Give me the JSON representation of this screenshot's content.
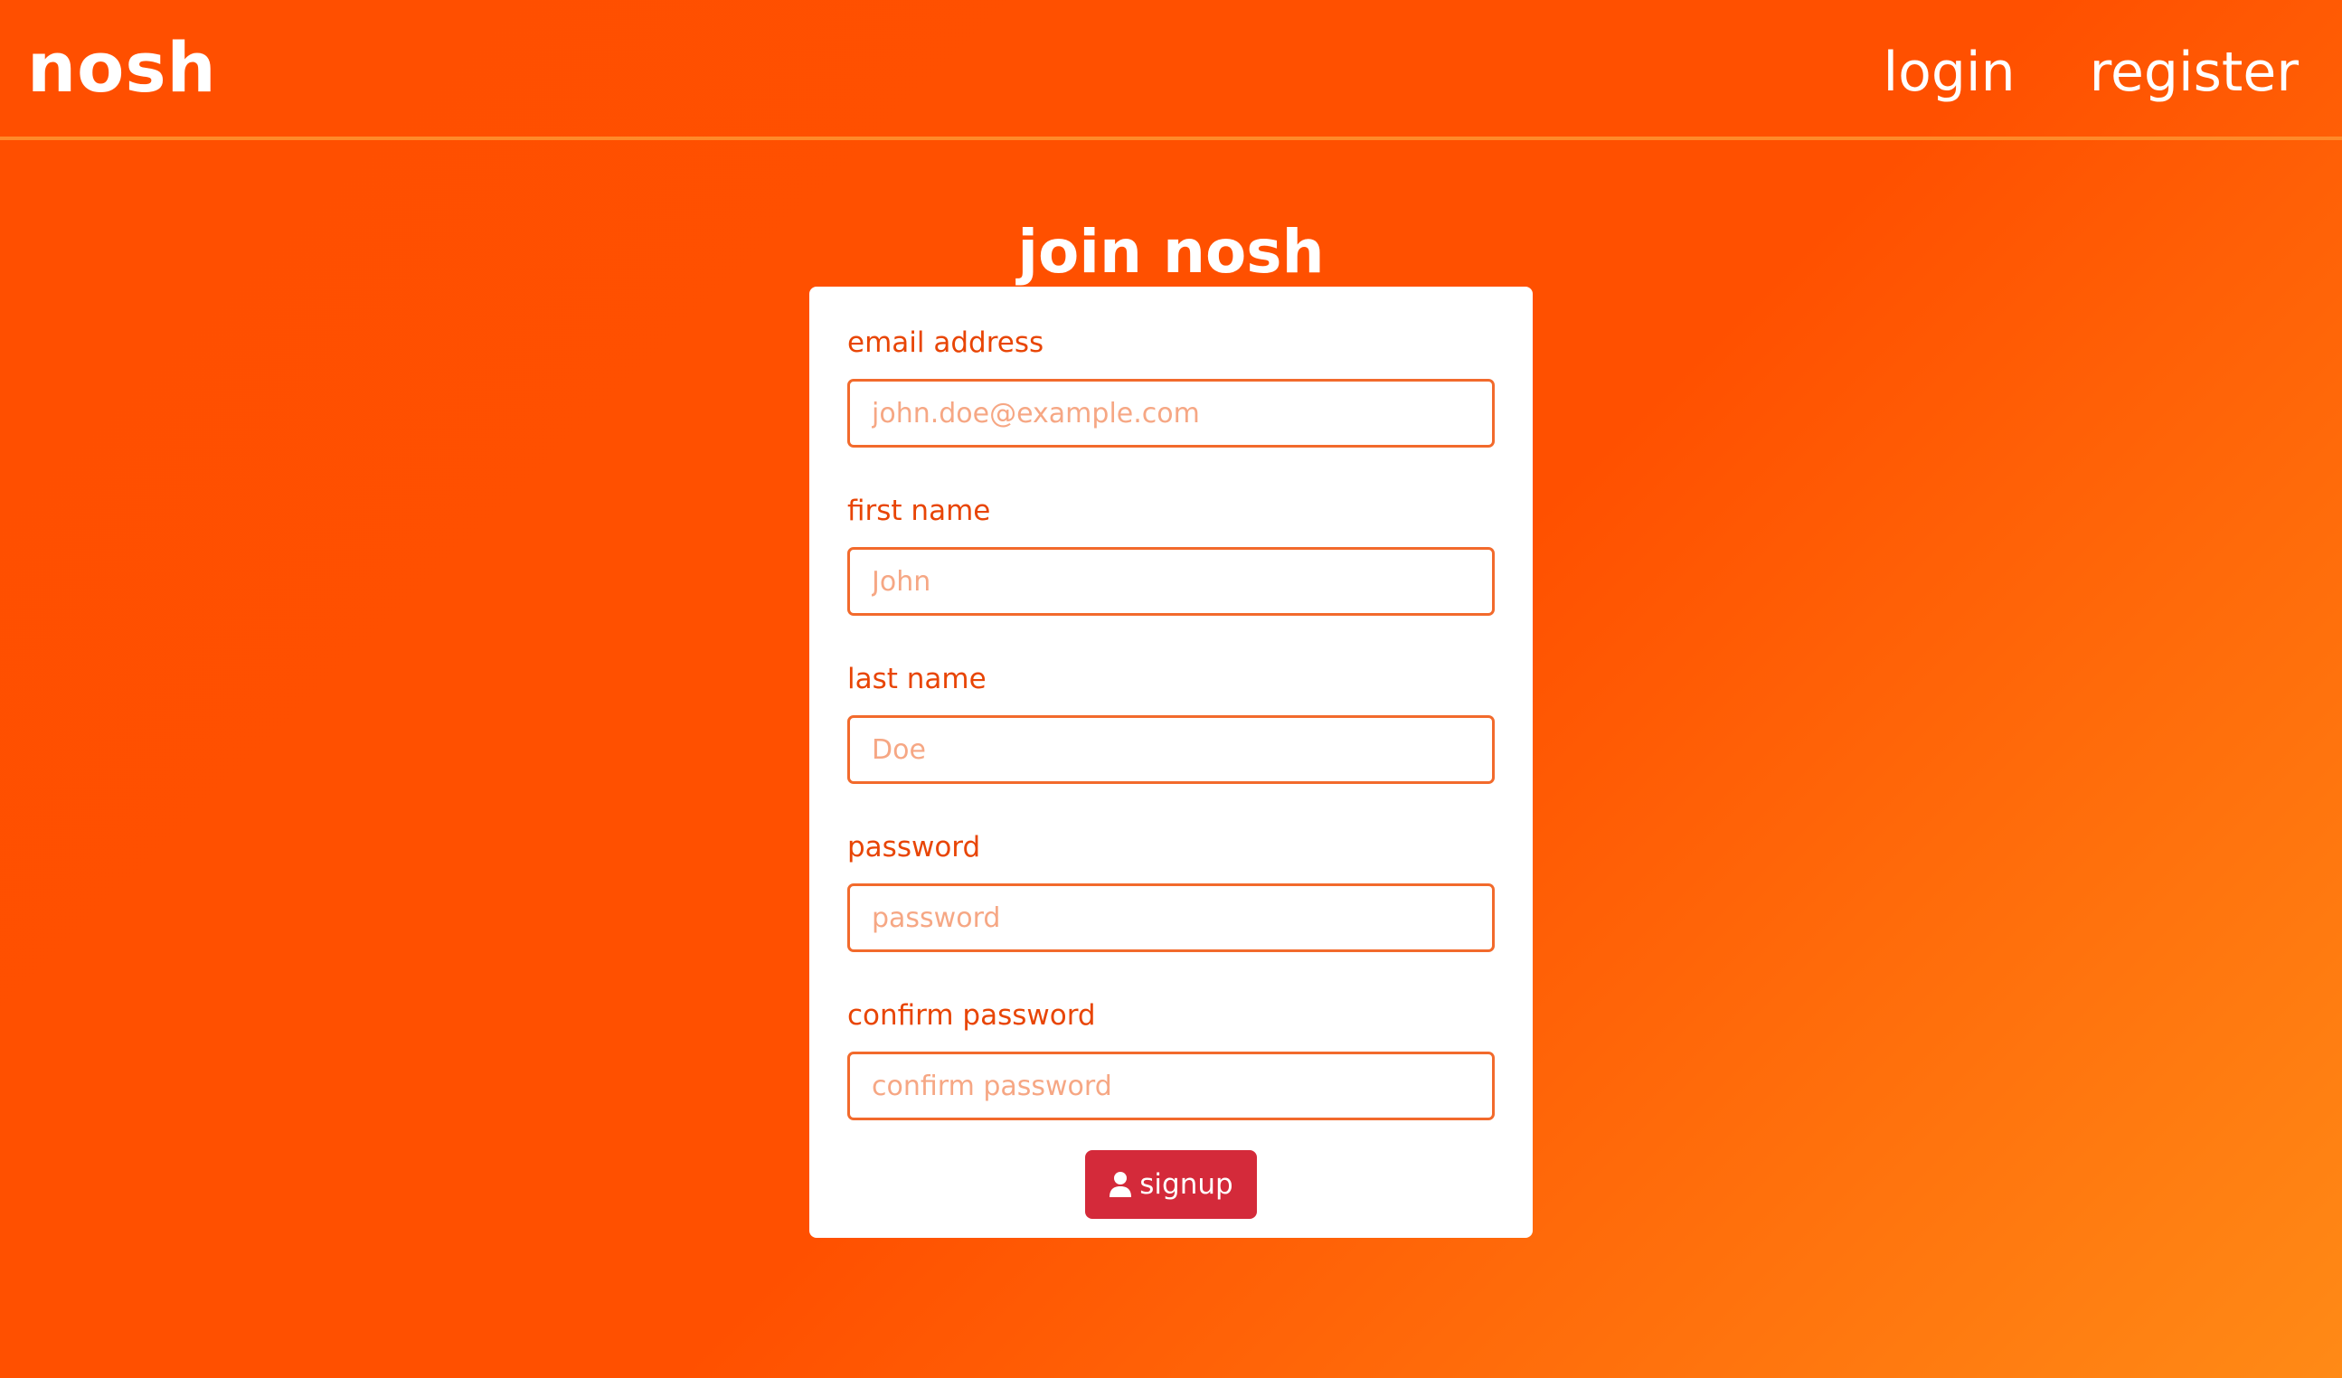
{
  "header": {
    "brand": "nosh",
    "nav": {
      "login": "login",
      "register": "register"
    }
  },
  "main": {
    "title": "join nosh",
    "form": {
      "fields": [
        {
          "label": "email address",
          "placeholder": "john.doe@example.com",
          "value": ""
        },
        {
          "label": "first name",
          "placeholder": "John",
          "value": ""
        },
        {
          "label": "last name",
          "placeholder": "Doe",
          "value": ""
        },
        {
          "label": "password",
          "placeholder": "password",
          "value": ""
        },
        {
          "label": "confirm password",
          "placeholder": "confirm password",
          "value": ""
        }
      ],
      "submit": {
        "label": "signup",
        "icon": "user-icon"
      }
    }
  },
  "colors": {
    "background_start": "#ff4f00",
    "background_end": "#ff8a16",
    "header_divider": "#ff8a2a",
    "label_text": "#e84505",
    "input_border": "#f26a2c",
    "placeholder_text": "#f6a784",
    "button_background": "#d42a3a"
  }
}
